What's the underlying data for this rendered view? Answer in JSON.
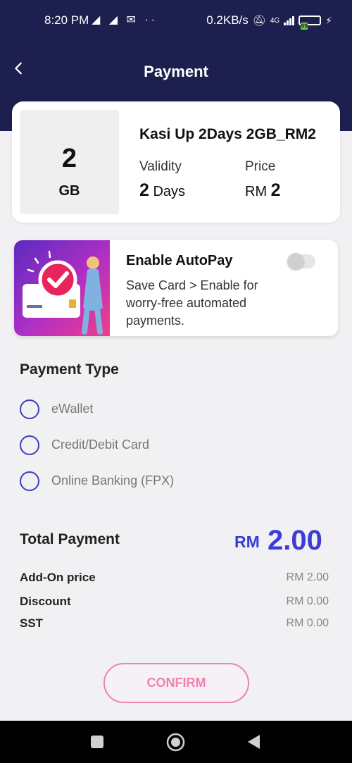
{
  "status_bar": {
    "time": "8:20 PM",
    "notification_icons": "◢ ◢ ✉ ··",
    "network_speed": "0.2KB/s",
    "network_type": "4G",
    "battery": "99"
  },
  "header": {
    "title": "Payment",
    "background_color": "#1d1f4f"
  },
  "plan": {
    "data_amount": "2",
    "data_unit": "GB",
    "name": "Kasi Up 2Days 2GB_RM2",
    "validity_label": "Validity",
    "validity_value": "2",
    "validity_unit": "Days",
    "price_label": "Price",
    "price_currency": "RM",
    "price_value": "2"
  },
  "autopay": {
    "title": "Enable AutoPay",
    "description": "Save Card > Enable for worry-free automated payments.",
    "enabled": false
  },
  "payment_type": {
    "title": "Payment Type",
    "options": [
      {
        "label": "eWallet",
        "selected": false
      },
      {
        "label": "Credit/Debit Card",
        "selected": false
      },
      {
        "label": "Online Banking (FPX)",
        "selected": false
      }
    ]
  },
  "summary": {
    "total_label": "Total Payment",
    "total_currency": "RM",
    "total_amount": "2.00",
    "rows": [
      {
        "label": "Add-On price",
        "value": "RM 2.00"
      },
      {
        "label": "Discount",
        "value": "RM 0.00"
      },
      {
        "label": "SST",
        "value": "RM 0.00"
      }
    ]
  },
  "confirm_label": "CONFIRM",
  "colors": {
    "accent": "#3a3dd6",
    "confirm": "#ef82b4"
  }
}
